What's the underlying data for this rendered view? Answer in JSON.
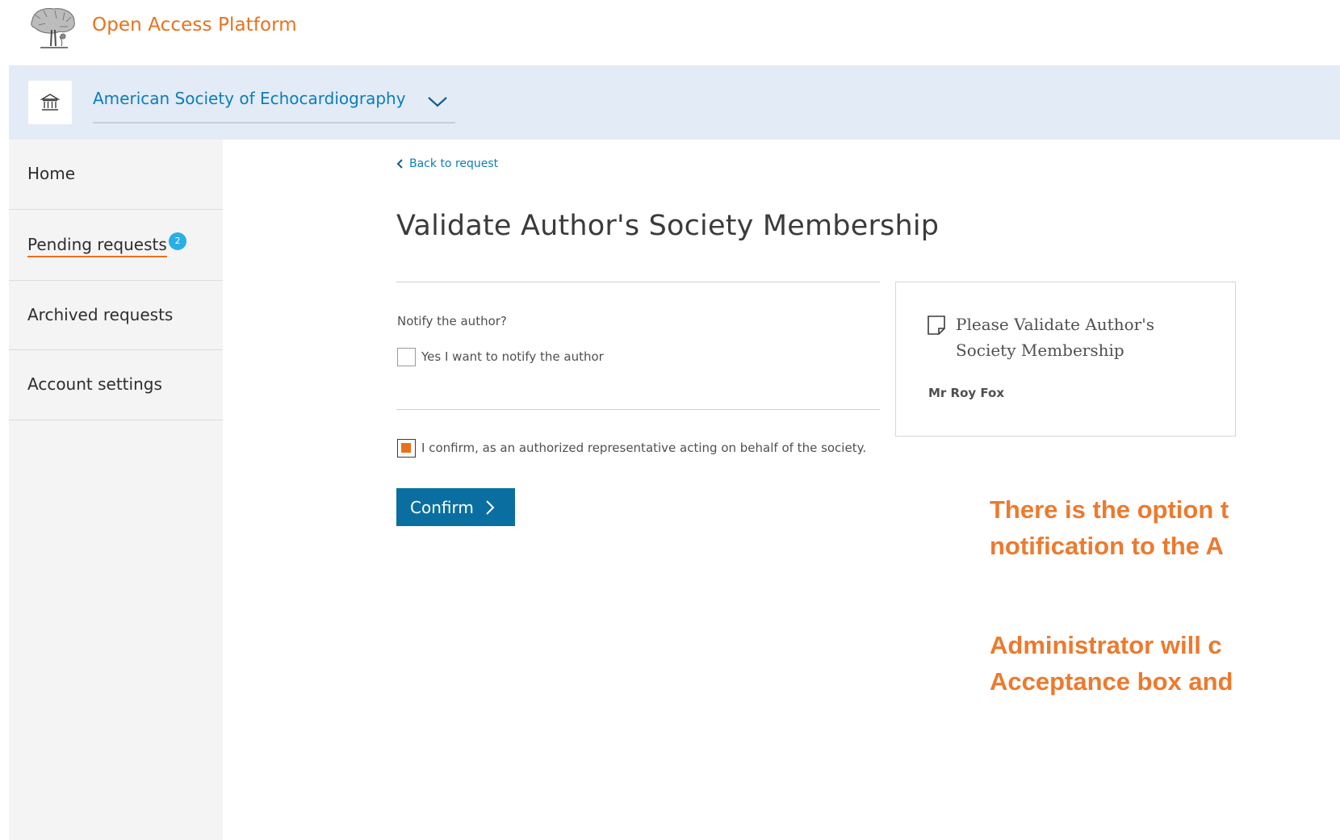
{
  "header": {
    "app_title": "Open Access Platform",
    "logo_icon": "elsevier-tree-logo"
  },
  "society_bar": {
    "institution_icon": "institution-icon",
    "society_name": "American Society of Echocardiography",
    "dropdown_icon": "chevron-down-icon"
  },
  "sidebar": {
    "items": [
      {
        "label": "Home"
      },
      {
        "label": "Pending requests",
        "badge": "2"
      },
      {
        "label": "Archived requests"
      },
      {
        "label": "Account settings"
      }
    ]
  },
  "main": {
    "back_link": "Back to request",
    "title": "Validate Author's Society Membership",
    "notify_question": "Notify the author?",
    "notify_checkbox_label": "Yes I want to notify the author",
    "notify_checked": false,
    "confirm_checkbox_label": "I confirm, as an authorized representative acting on behalf of the society.",
    "confirm_checked": true,
    "confirm_button": "Confirm"
  },
  "card": {
    "icon": "document-icon",
    "title": "Please Validate Author's Society Membership",
    "author_name": "Mr Roy Fox"
  },
  "annotations": {
    "note1_line1": "There is the option t",
    "note1_line2": "notification to the A",
    "note2_line1": "Administrator will c",
    "note2_line2": "Acceptance box and"
  },
  "colors": {
    "accent_orange": "#e9711c",
    "link_blue": "#0c7dbb",
    "button_blue": "#0a6fa0",
    "badge_blue": "#2aaee6",
    "society_bar_bg": "#e3ebf6"
  }
}
